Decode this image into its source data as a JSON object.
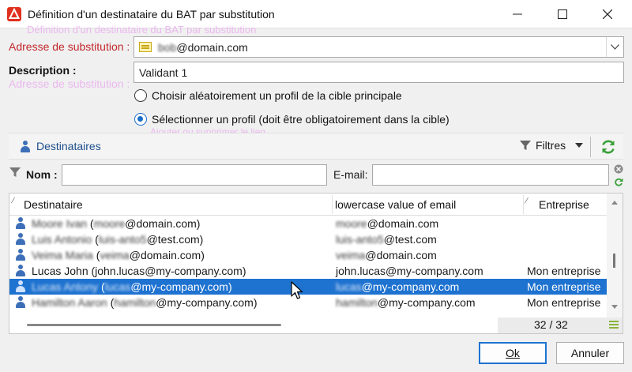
{
  "window": {
    "title": "Définition d'un destinataire du BAT par substitution",
    "controls": {
      "minimize": "—",
      "maximize": "☐",
      "close": "✕"
    },
    "icon": "adobe-campaign-icon"
  },
  "ghost_texts": {
    "behind_title": "Définition d'un destinataire du BAT par substitution",
    "behind_description": "Adresse de substitution :",
    "behind_toolbar": "Ajouter ou supprimer le lien"
  },
  "substitution": {
    "label": "Adresse de substitution :",
    "value_blurred": "bob",
    "value_domain": "@domain.com"
  },
  "description": {
    "label": "Description :",
    "value": "Validant 1"
  },
  "options": {
    "random_profile": "Choisir aléatoirement un profil de la cible principale",
    "select_profile": "Sélectionner un profil (doit être obligatoirement dans la cible)",
    "selected": "select_profile"
  },
  "toolbar": {
    "recipients_label": "Destinataires",
    "filters_label": "Filtres"
  },
  "filters": {
    "name_label": "Nom :",
    "name_value": "",
    "email_label": "E-mail:",
    "email_value": ""
  },
  "grid": {
    "columns": {
      "recipient": "Destinataire",
      "email": "lowercase value of email",
      "company": "Entreprise"
    },
    "rows": [
      {
        "name_blur": "Moore Ivan",
        "mid": " (",
        "local_blur": "moore",
        "domain": "@domain.com)",
        "email_blur": "moore",
        "email_domain": "@domain.com",
        "company": ""
      },
      {
        "name_blur": "Luis Antonio",
        "mid": " (",
        "local_blur": "luis-anto5",
        "domain": "@test.com)",
        "email_blur": "luis-anto5",
        "email_domain": "@test.com",
        "company": ""
      },
      {
        "name_blur": "Veima Maria",
        "mid": " (",
        "local_blur": "veima",
        "domain": "@domain.com)",
        "email_blur": "veima",
        "email_domain": "@domain.com",
        "company": ""
      },
      {
        "name_blur": "",
        "name_clear": "Lucas John (john.lucas@my-company.com)",
        "email_clear": "john.lucas@my-company.com",
        "company": "Mon entreprise"
      },
      {
        "name_blur": "Lucas Antony",
        "mid": " (",
        "local_blur": "lucas",
        "domain": "@my-company.com)",
        "email_blur": "lucas",
        "email_domain": "@my-company.com",
        "company": "Mon entreprise",
        "selected": true
      },
      {
        "name_blur": "Hamilton Aaron",
        "mid": " (",
        "local_blur": "hamilton",
        "domain": "@my-company.com)",
        "email_blur": "hamilton",
        "email_domain": "@my-company.com",
        "company": "Mon entreprise"
      }
    ],
    "counter": "32 / 32"
  },
  "buttons": {
    "ok": "Ok",
    "cancel": "Annuler"
  },
  "colors": {
    "label_red": "#c2272d",
    "selection_blue": "#1e72d0",
    "refresh_green": "#3aa03a"
  }
}
